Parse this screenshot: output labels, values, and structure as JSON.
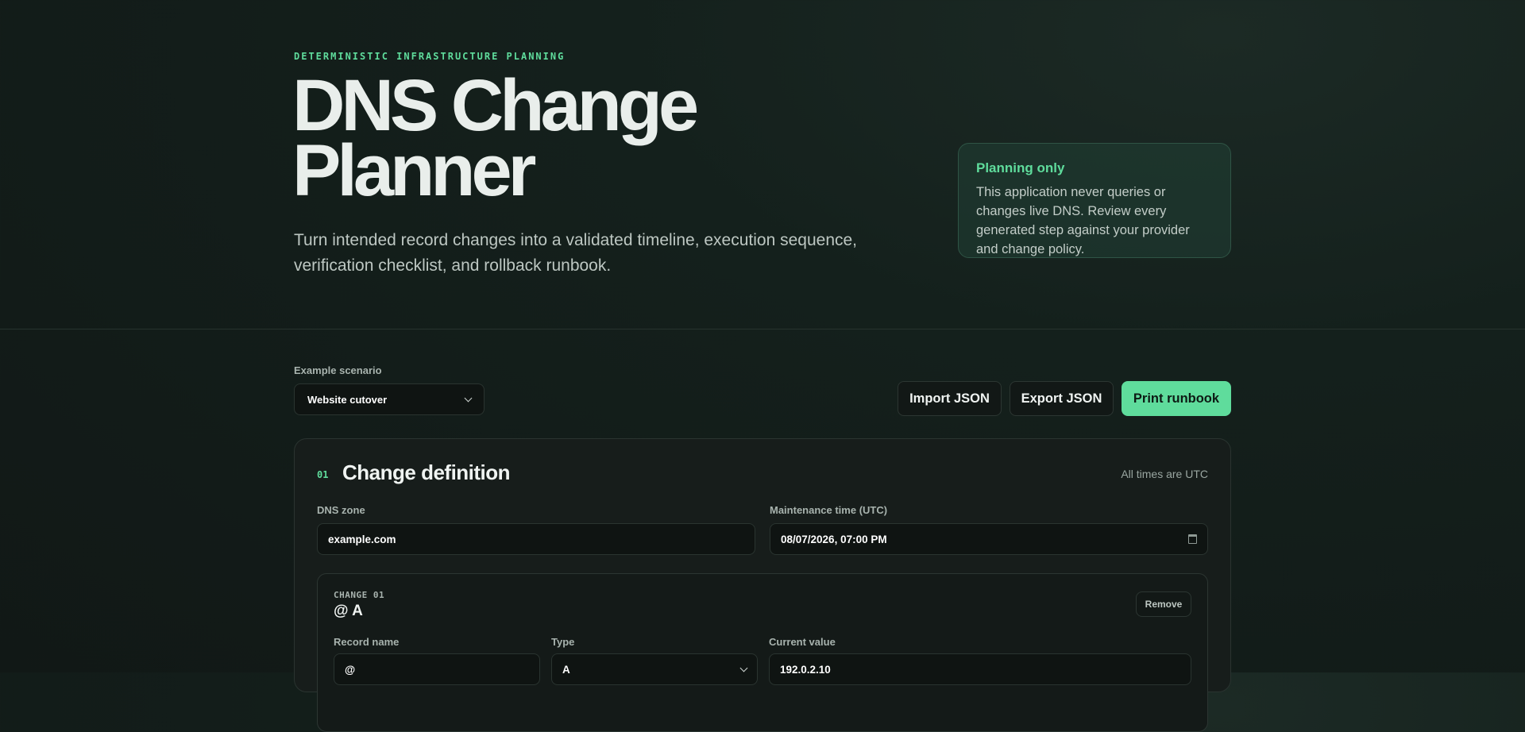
{
  "hero": {
    "eyebrow": "DETERMINISTIC INFRASTRUCTURE PLANNING",
    "title_line1": "DNS Change",
    "title_line2": "Planner",
    "subtitle": "Turn intended record changes into a validated timeline, execution sequence, verification checklist, and rollback runbook."
  },
  "notice": {
    "title": "Planning only",
    "body": "This application never queries or changes live DNS. Review every generated step against your provider and change policy."
  },
  "toolbar": {
    "scenario_label": "Example scenario",
    "scenario_value": "Website cutover",
    "import_label": "Import JSON",
    "export_label": "Export JSON",
    "print_label": "Print runbook"
  },
  "definition": {
    "step": "01",
    "title": "Change definition",
    "utc_note": "All times are UTC",
    "zone_label": "DNS zone",
    "zone_value": "example.com",
    "maintenance_label": "Maintenance time (UTC)",
    "maintenance_value": "08/07/2026, 07:00 PM"
  },
  "change": {
    "label": "CHANGE 01",
    "title": "@ A",
    "remove_label": "Remove",
    "record_name_label": "Record name",
    "record_name_value": "@",
    "type_label": "Type",
    "type_value": "A",
    "current_value_label": "Current value",
    "current_value": "192.0.2.10"
  },
  "colors": {
    "accent": "#5fdc9c",
    "background": "#111816",
    "panel": "#171d1b"
  }
}
